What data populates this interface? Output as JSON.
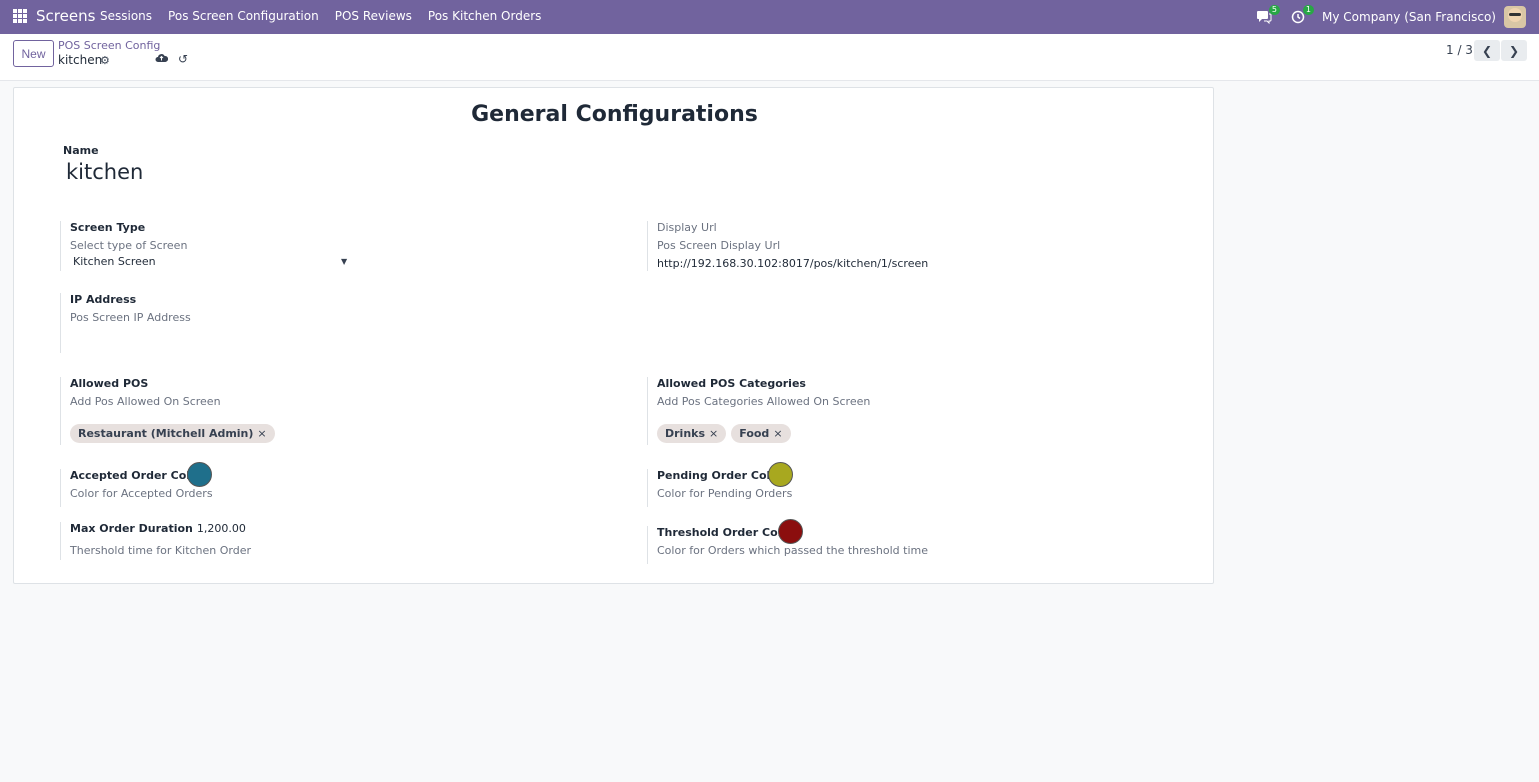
{
  "nav": {
    "app_name": "Screens",
    "menu": [
      "Sessions",
      "Pos Screen Configuration",
      "POS Reviews",
      "Pos Kitchen Orders"
    ],
    "messages_badge": "5",
    "activities_badge": "1",
    "company": "My Company (San Francisco)"
  },
  "control": {
    "new_label": "New",
    "breadcrumb": "POS Screen Config",
    "record_name": "kitchen",
    "pager": "1 / 3"
  },
  "form": {
    "title": "General Configurations",
    "name_label": "Name",
    "name_value": "kitchen",
    "screen_type": {
      "label": "Screen Type",
      "help": "Select type of Screen",
      "value": "Kitchen Screen"
    },
    "display_url": {
      "label": "Display Url",
      "help": "Pos Screen Display Url",
      "value": "http://192.168.30.102:8017/pos/kitchen/1/screen"
    },
    "ip_address": {
      "label": "IP Address",
      "help": "Pos Screen IP Address"
    },
    "allowed_pos": {
      "label": "Allowed POS",
      "help": "Add Pos Allowed On Screen",
      "tags": [
        "Restaurant (Mitchell Admin)"
      ]
    },
    "allowed_categories": {
      "label": "Allowed POS Categories",
      "help": "Add Pos Categories Allowed On Screen",
      "tags": [
        "Drinks",
        "Food"
      ]
    },
    "accepted_colors": {
      "label": "Accepted Order Colors",
      "help": "Color for Accepted Orders",
      "color": "#1f6f8b"
    },
    "pending_colors": {
      "label": "Pending Order Colors",
      "help": "Color for Pending Orders",
      "color": "#a8a81f"
    },
    "max_duration": {
      "label": "Max Order Duration",
      "value": "1,200.00",
      "help": "Thershold time for Kitchen Order"
    },
    "threshold_colors": {
      "label": "Threshold Order Colors",
      "help": "Color for Orders which passed the threshold time",
      "color": "#8b0e0e"
    }
  },
  "colors": {
    "brand": "#71639e"
  }
}
